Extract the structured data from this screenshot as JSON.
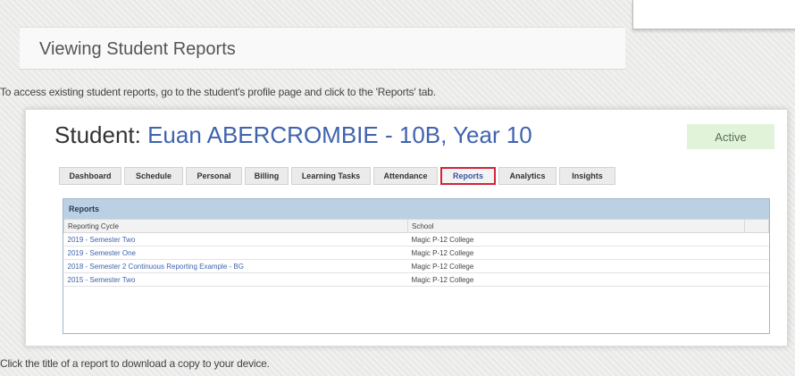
{
  "page": {
    "section_title": "Viewing Student Reports",
    "intro": "To access existing student reports, go to the student's profile page and click to the 'Reports' tab.",
    "outro": "Click the title of a report to download a copy to your device."
  },
  "student": {
    "label": "Student:",
    "name": "Euan ABERCROMBIE - 10B, Year 10",
    "status": "Active"
  },
  "tabs": [
    {
      "label": "Dashboard"
    },
    {
      "label": "Schedule"
    },
    {
      "label": "Personal"
    },
    {
      "label": "Billing"
    },
    {
      "label": "Learning Tasks"
    },
    {
      "label": "Attendance"
    },
    {
      "label": "Reports",
      "active": true
    },
    {
      "label": "Analytics"
    },
    {
      "label": "Insights"
    }
  ],
  "reports": {
    "title": "Reports",
    "columns": [
      "Reporting Cycle",
      "School"
    ],
    "rows": [
      {
        "cycle": "2019 - Semester Two",
        "school": "Magic P-12 College"
      },
      {
        "cycle": "2019 - Semester One",
        "school": "Magic P-12 College"
      },
      {
        "cycle": "2018 - Semester 2 Continuous Reporting Example - BG",
        "school": "Magic P-12 College"
      },
      {
        "cycle": "2015 - Semester Two",
        "school": "Magic P-12 College"
      }
    ]
  },
  "colors": {
    "student_name": "#3f63ae",
    "active_badge_bg": "#e1f3d9",
    "active_tab_border": "#d0243b",
    "reports_header_bg": "#bcd0e4"
  }
}
